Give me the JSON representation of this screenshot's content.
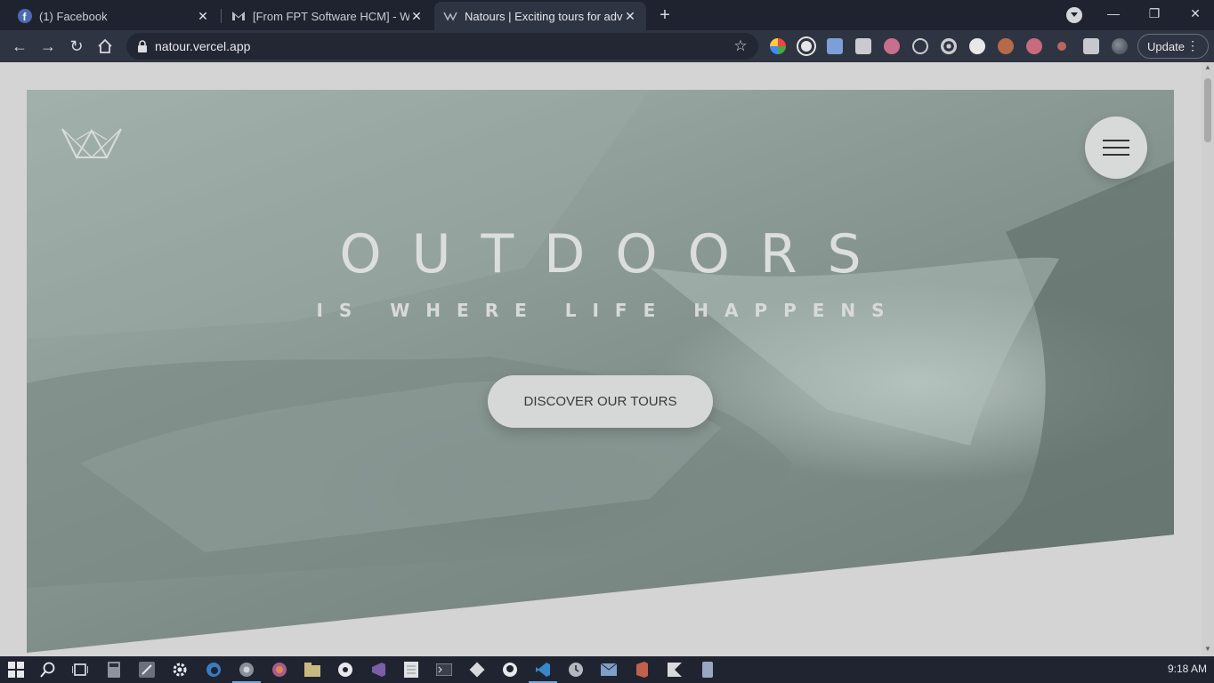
{
  "browser": {
    "tabs": [
      {
        "title": "(1) Facebook",
        "icon": "facebook-icon",
        "active": false
      },
      {
        "title": "[From FPT Software HCM] - Welc",
        "icon": "gmail-icon",
        "active": false
      },
      {
        "title": "Natours | Exciting tours for adver",
        "icon": "natours-favicon",
        "active": true
      }
    ],
    "url": "natour.vercel.app",
    "update_label": "Update",
    "extensions": [
      "color-picker-icon",
      "dark-reader-icon",
      "translate-icon",
      "camera-icon",
      "ext-t-icon",
      "react-devtools-icon",
      "target-icon",
      "moon-icon",
      "fox-icon",
      "hand-icon",
      "drop-icon",
      "puzzle-icon",
      "profile-icon"
    ]
  },
  "page": {
    "headline": "OUTDOORS",
    "subheadline": "IS WHERE LIFE HAPPENS",
    "cta_label": "DISCOVER OUR TOURS",
    "accent_color": "#55c57a"
  },
  "taskbar": {
    "clock": "9:18 AM",
    "apps": [
      "start-icon",
      "search-icon",
      "task-view-icon",
      "calculator-icon",
      "snip-icon",
      "settings-icon",
      "edge-icon",
      "chrome-icon",
      "firefox-icon",
      "file-explorer-icon",
      "app-icon",
      "visual-studio-icon",
      "notepad-icon",
      "terminal-icon",
      "git-icon",
      "github-icon",
      "vscode-icon",
      "clock-app-icon",
      "mail-icon",
      "office-icon",
      "kotlin-icon",
      "phone-icon"
    ]
  }
}
